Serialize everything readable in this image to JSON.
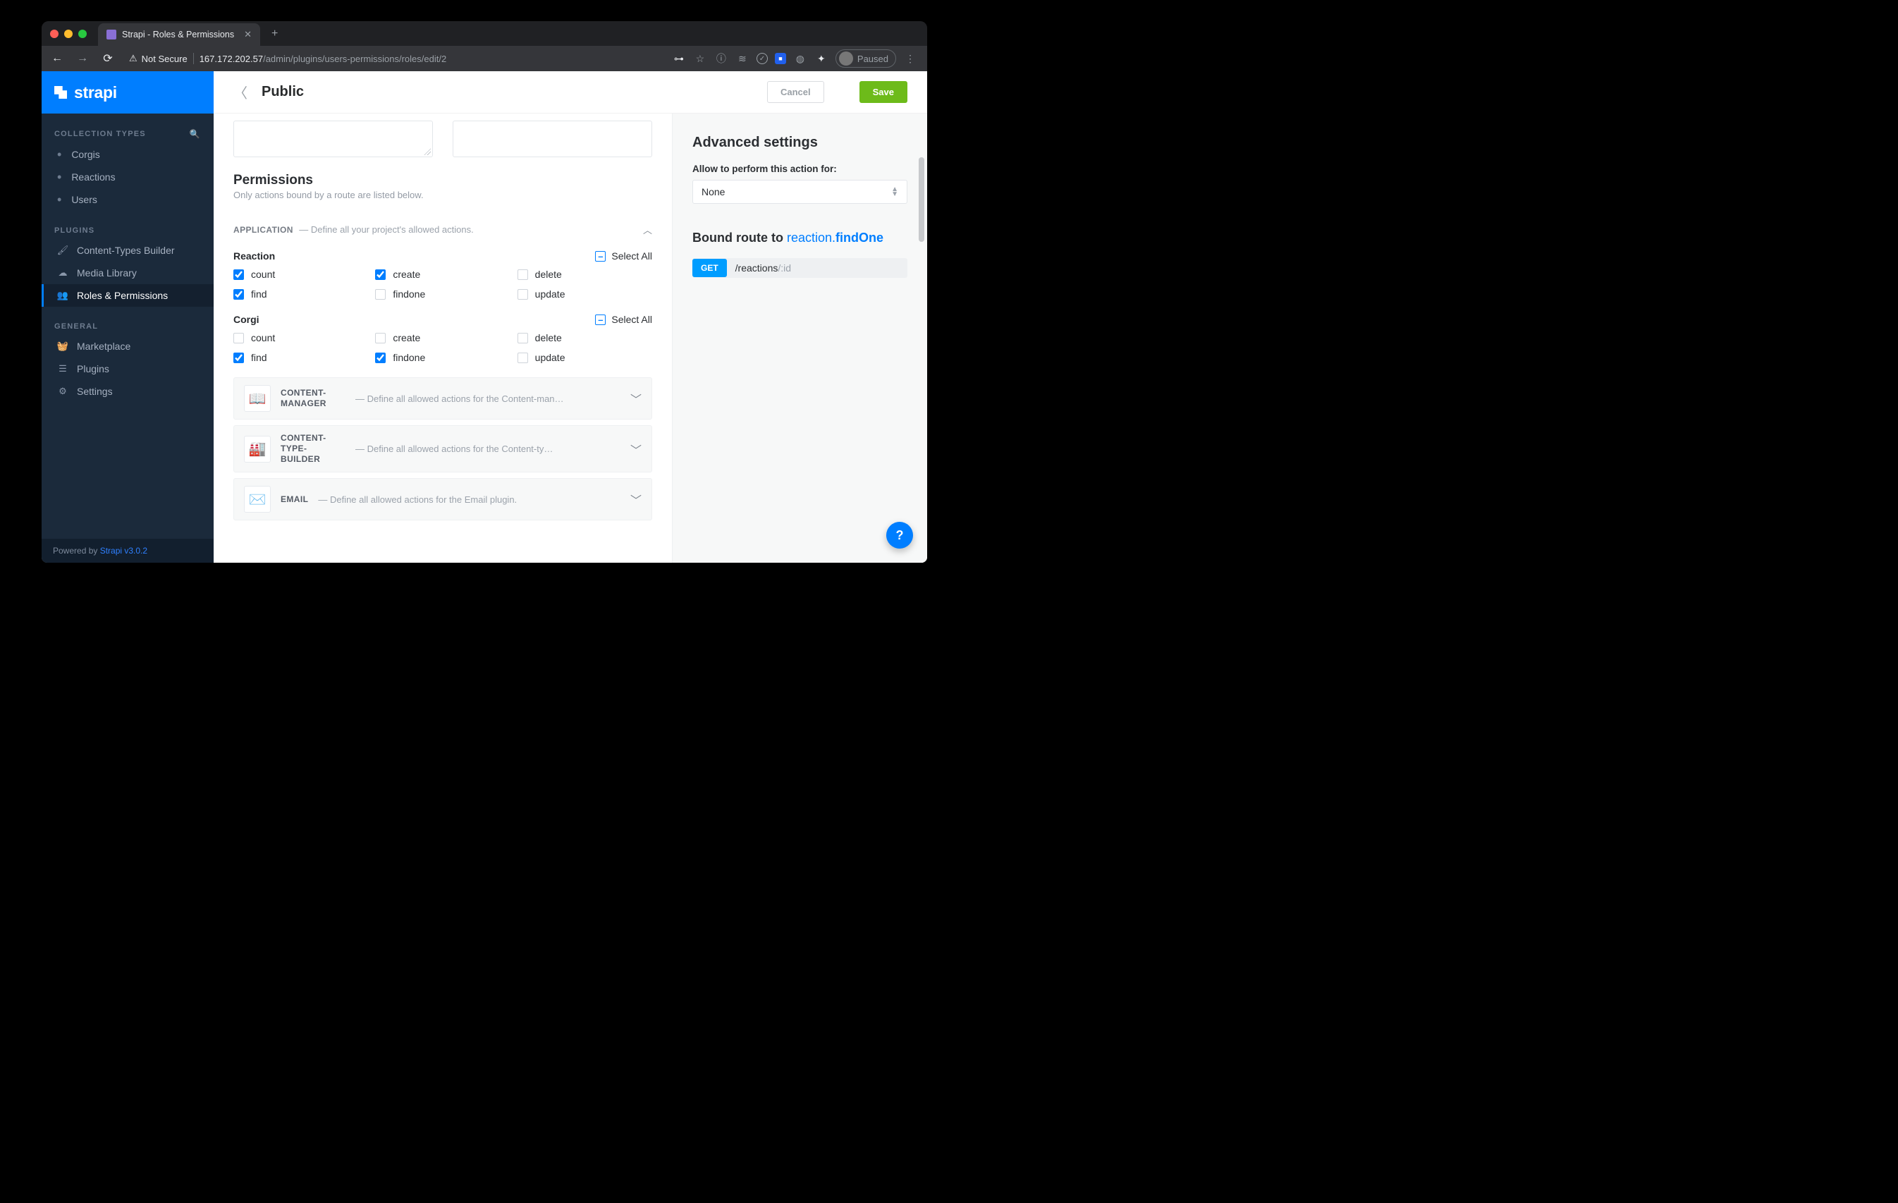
{
  "browser": {
    "tab_title": "Strapi - Roles & Permissions",
    "nav_back": "←",
    "nav_fwd": "→",
    "nav_reload": "⟳",
    "security_label": "Not Secure",
    "url_host": "167.172.202.57",
    "url_path": "/admin/plugins/users-permissions/roles/edit/2",
    "paused": "Paused"
  },
  "sidebar": {
    "brand": "strapi",
    "sections": {
      "collection_types": "COLLECTION TYPES",
      "plugins": "PLUGINS",
      "general": "GENERAL"
    },
    "collection_items": [
      {
        "label": "Corgis"
      },
      {
        "label": "Reactions"
      },
      {
        "label": "Users"
      }
    ],
    "plugin_items": [
      {
        "label": "Content-Types Builder",
        "active": false
      },
      {
        "label": "Media Library",
        "active": false
      },
      {
        "label": "Roles & Permissions",
        "active": true
      }
    ],
    "general_items": [
      {
        "label": "Marketplace"
      },
      {
        "label": "Plugins"
      },
      {
        "label": "Settings"
      }
    ],
    "footer_prefix": "Powered by ",
    "footer_link": "Strapi v3.0.2"
  },
  "header": {
    "title": "Public",
    "cancel": "Cancel",
    "save": "Save"
  },
  "permissions": {
    "title": "Permissions",
    "subtitle": "Only actions bound by a route are listed below.",
    "application_label": "APPLICATION",
    "application_desc": "— Define all your project's allowed actions.",
    "select_all": "Select All",
    "models": [
      {
        "name": "Reaction",
        "actions": [
          {
            "name": "count",
            "checked": true
          },
          {
            "name": "create",
            "checked": true
          },
          {
            "name": "delete",
            "checked": false
          },
          {
            "name": "find",
            "checked": true
          },
          {
            "name": "findone",
            "checked": false
          },
          {
            "name": "update",
            "checked": false
          }
        ]
      },
      {
        "name": "Corgi",
        "actions": [
          {
            "name": "count",
            "checked": false
          },
          {
            "name": "create",
            "checked": false
          },
          {
            "name": "delete",
            "checked": false
          },
          {
            "name": "find",
            "checked": true
          },
          {
            "name": "findone",
            "checked": true
          },
          {
            "name": "update",
            "checked": false
          }
        ]
      }
    ],
    "plugins": [
      {
        "emoji": "📖",
        "name": "CONTENT-MANAGER",
        "desc": "— Define all allowed actions for the Content-man…"
      },
      {
        "emoji": "🏭",
        "name": "CONTENT-TYPE-BUILDER",
        "desc": "— Define all allowed actions for the Content-ty…"
      },
      {
        "emoji": "✉️",
        "name": "EMAIL",
        "desc": "— Define all allowed actions for the Email plugin."
      }
    ]
  },
  "advanced": {
    "title": "Advanced settings",
    "allow_label": "Allow to perform this action for:",
    "select_value": "None",
    "bound_prefix": "Bound route to ",
    "bound_controller": "reaction",
    "bound_dot": ".",
    "bound_action": "findOne",
    "route_method": "GET",
    "route_path_base": "/reactions",
    "route_path_param": "/:id"
  },
  "help": "?"
}
